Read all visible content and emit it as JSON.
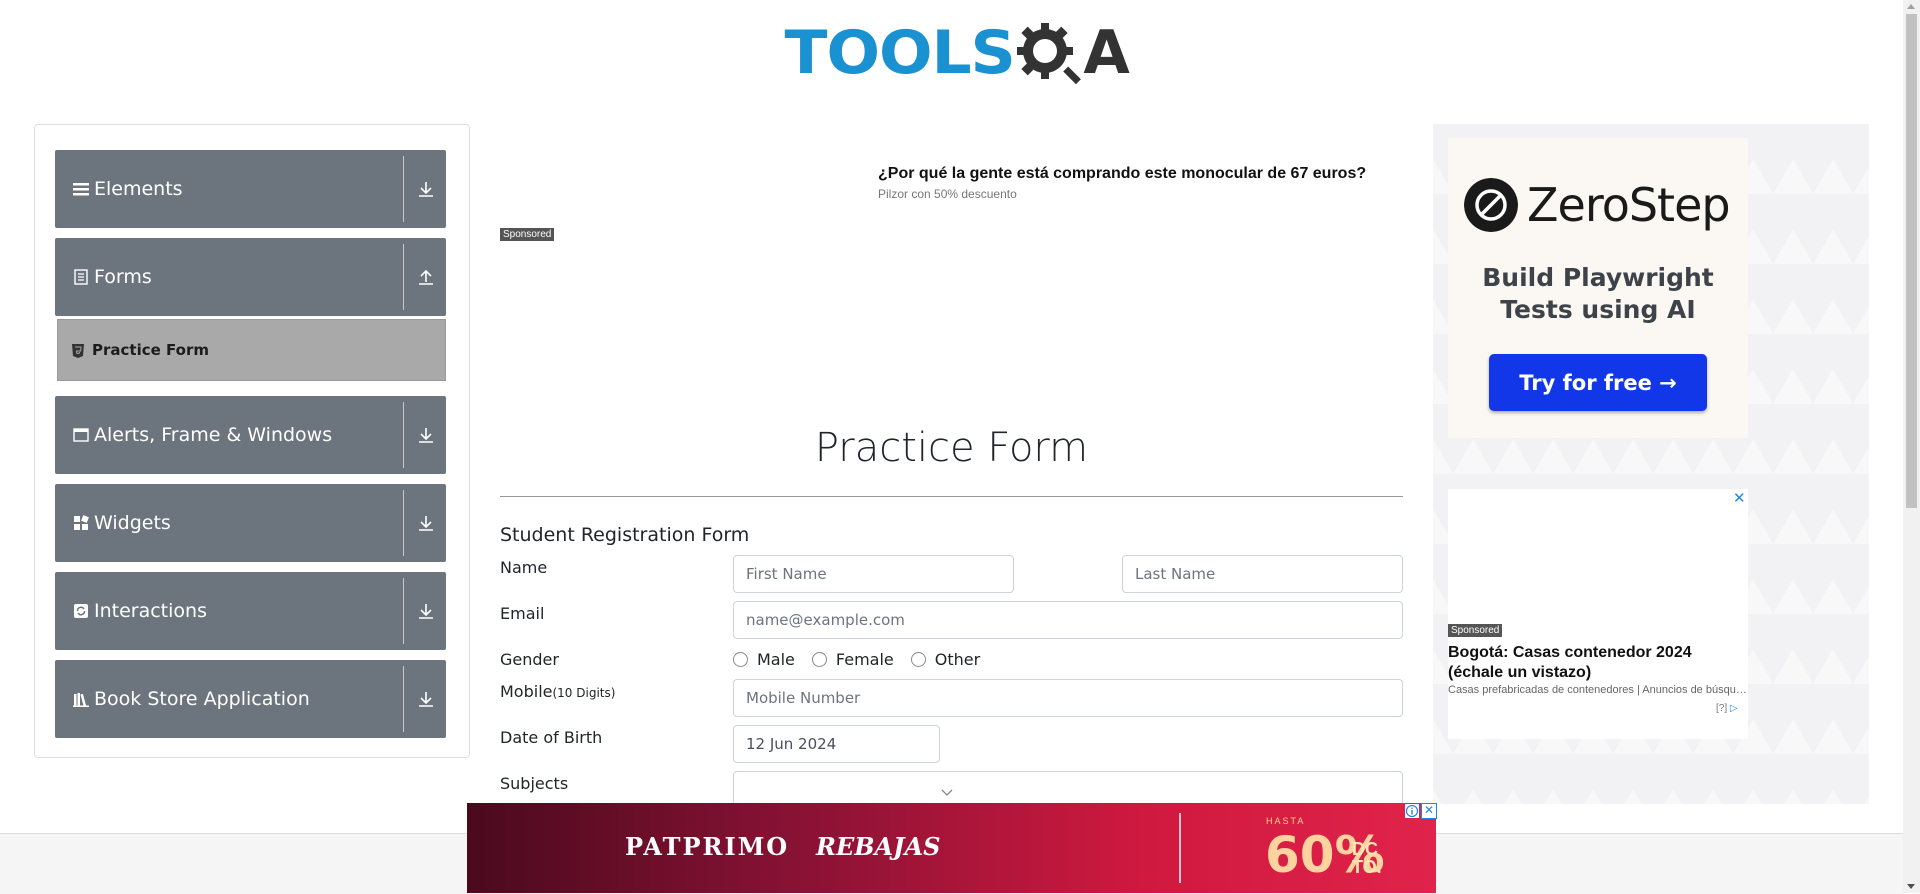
{
  "header": {
    "logo_text_left": "TOOLS",
    "logo_text_right": "A"
  },
  "nav": {
    "groups": [
      {
        "label": "Elements",
        "icon": "list-icon",
        "arrow": "download-icon"
      },
      {
        "label": "Forms",
        "icon": "file-text-icon",
        "arrow": "upload-icon"
      },
      {
        "label": "Alerts, Frame & Windows",
        "icon": "window-icon",
        "arrow": "download-icon"
      },
      {
        "label": "Widgets",
        "icon": "grid-icon",
        "arrow": "download-icon"
      },
      {
        "label": "Interactions",
        "icon": "refresh-icon",
        "arrow": "download-icon"
      },
      {
        "label": "Book Store Application",
        "icon": "books-icon",
        "arrow": "download-icon"
      }
    ],
    "active_item": {
      "label": "Practice Form",
      "icon": "html5-icon"
    }
  },
  "top_ad": {
    "title": "¿Por qué la gente está comprando este monocular de 67 euros?",
    "subtitle": "Pilzor con 50% descuento",
    "sponsored": "Sponsored"
  },
  "main": {
    "title": "Practice Form",
    "form_heading": "Student Registration Form",
    "labels": {
      "name": "Name",
      "email": "Email",
      "gender": "Gender",
      "mobile": "Mobile",
      "mobile_hint": "(10 Digits)",
      "dob": "Date of Birth",
      "subjects": "Subjects"
    },
    "placeholders": {
      "first_name": "First Name",
      "last_name": "Last Name",
      "email": "name@example.com",
      "mobile": "Mobile Number"
    },
    "values": {
      "dob": "12 Jun 2024"
    },
    "gender_options": [
      "Male",
      "Female",
      "Other"
    ]
  },
  "right_ads": {
    "zerostep": {
      "name": "ZeroStep",
      "tagline": "Build Playwright Tests using AI",
      "button": "Try for free →"
    },
    "ad2": {
      "close": "✕",
      "sponsored": "Sponsored",
      "title": "Bogotá: Casas contenedor 2024 (échale un vistazo)",
      "subtitle": "Casas prefabricadas de contenedores | Anuncios de búsqueda",
      "adchoices": "[?]"
    }
  },
  "bottom_banner": {
    "brand": "PATPRIMO",
    "sale": "REBAJAS",
    "hasta": "HASTA",
    "percent": "60%",
    "dcto_line1": "DC",
    "dcto_line2": "TO.",
    "close": "✕"
  },
  "colors": {
    "nav_bg": "#6c757d",
    "active_bg": "#a9a9a9",
    "brand_blue": "#1a91d0",
    "cta_blue": "#1237e8"
  }
}
